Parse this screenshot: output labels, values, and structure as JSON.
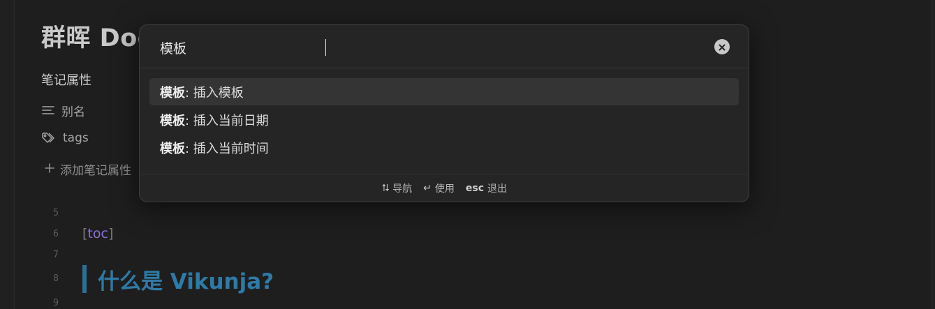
{
  "document": {
    "title": "群晖 Docker 部署搭建与实现管理 Vikunja",
    "properties_heading": "笔记属性",
    "properties": [
      {
        "icon": "text-lines-icon",
        "label": "别名"
      },
      {
        "icon": "tags-icon",
        "label": "tags"
      }
    ],
    "add_property_label": "添加笔记属性",
    "lines": {
      "l5": "5",
      "l6": "6",
      "l7": "7",
      "l8": "8",
      "l9": "9"
    },
    "toc_open": "[",
    "toc_word": "toc",
    "toc_close": "]",
    "heading": "什么是 Vikunja?"
  },
  "palette": {
    "query": "模板",
    "results": [
      {
        "match": "模板",
        "rest": ": 插入模板",
        "selected": true
      },
      {
        "match": "模板",
        "rest": ": 插入当前日期",
        "selected": false
      },
      {
        "match": "模板",
        "rest": ": 插入当前时间",
        "selected": false
      }
    ],
    "footer": {
      "nav_key": "⮁",
      "nav_label": "导航",
      "use_key": "↵",
      "use_label": "使用",
      "esc_key": "esc",
      "esc_label": "退出"
    }
  },
  "colors": {
    "background": "#1e1e1e",
    "palette_bg": "#252525",
    "selected_row": "#343434",
    "heading_blue": "#2f7aa6",
    "toc_purple": "#8c6fd6"
  }
}
